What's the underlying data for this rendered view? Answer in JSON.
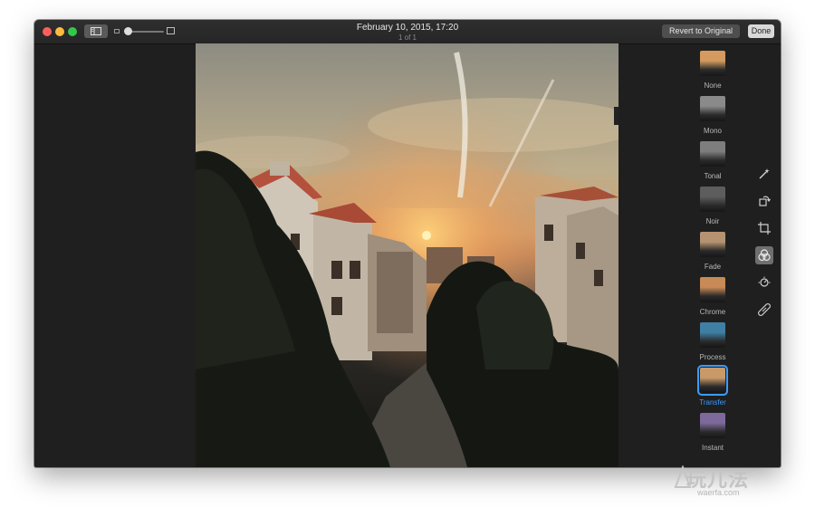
{
  "window": {
    "title": "February 10, 2015, 17:20",
    "subtitle": "1 of 1",
    "revert_label": "Revert to Original",
    "done_label": "Done"
  },
  "filters": [
    {
      "label": "None",
      "tint": "#d49a5f",
      "selected": false
    },
    {
      "label": "Mono",
      "tint": "#8a8a8a",
      "selected": false
    },
    {
      "label": "Tonal",
      "tint": "#7e7e7e",
      "selected": false
    },
    {
      "label": "Noir",
      "tint": "#5d5d5d",
      "selected": false
    },
    {
      "label": "Fade",
      "tint": "#b59372",
      "selected": false
    },
    {
      "label": "Chrome",
      "tint": "#c88a56",
      "selected": false
    },
    {
      "label": "Process",
      "tint": "#3e7fa3",
      "selected": false
    },
    {
      "label": "Transfer",
      "tint": "#c99a68",
      "selected": true
    },
    {
      "label": "Instant",
      "tint": "#7d6a9b",
      "selected": false
    }
  ],
  "tools": [
    "magic-wand-icon",
    "rotate-icon",
    "crop-icon",
    "filters-icon",
    "adjust-icon",
    "retouch-icon"
  ],
  "watermark": {
    "text": "玩儿法",
    "url": "waerfa.com"
  },
  "colors": {
    "accent": "#3a9bff",
    "window_bg": "#1f1f1f"
  }
}
